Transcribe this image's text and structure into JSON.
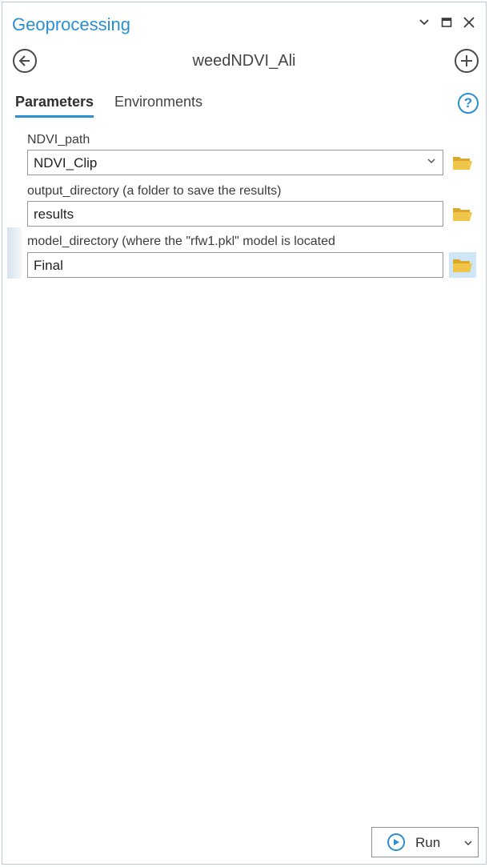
{
  "window": {
    "title": "Geoprocessing",
    "controls": [
      "chevron-down-icon",
      "maximize-icon",
      "close-icon"
    ]
  },
  "tool": {
    "title": "weedNDVI_Ali",
    "back_icon": "back-arrow-icon",
    "add_icon": "add-icon"
  },
  "tabs": [
    {
      "label": "Parameters",
      "active": true
    },
    {
      "label": "Environments",
      "active": false
    }
  ],
  "help_icon": "?",
  "parameters": [
    {
      "label": "NDVI_path",
      "value": "NDVI_Clip",
      "type": "dropdown"
    },
    {
      "label": "output_directory (a folder to save the results)",
      "value": "results",
      "type": "text"
    },
    {
      "label": "model_directory (where the \"rfw1.pkl\" model is located",
      "value": "Final",
      "type": "text"
    }
  ],
  "run_button": {
    "label": "Run"
  },
  "colors": {
    "accent": "#2a8fcf",
    "folder": "#e6b93a",
    "folder_hover_bg": "#cfe6f7"
  }
}
